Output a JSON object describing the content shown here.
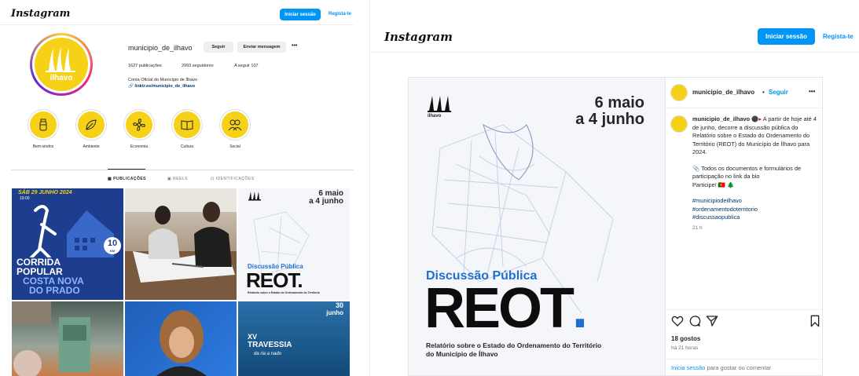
{
  "profile_page": {
    "brand": "Instagram",
    "login_label": "Iniciar sessão",
    "signup_label": "Regista-te",
    "username": "municipio_de_ilhavo",
    "follow_label": "Seguir",
    "message_label": "Enviar mensagem",
    "more_label": "•••",
    "stats": {
      "posts": "1627 publicações",
      "followers": "2993 seguidores",
      "following": "A seguir 107"
    },
    "bio": "Conta Oficial do Município de Ílhavo",
    "link": "linktr.ee/municipio_de_ilhavo",
    "avatar_text": "ílhavo",
    "highlights": [
      {
        "label": "Bem-vindos",
        "icon": "bottle-icon"
      },
      {
        "label": "Ambiente",
        "icon": "leaf-icon"
      },
      {
        "label": "Economia",
        "icon": "fan-icon"
      },
      {
        "label": "Cultura",
        "icon": "book-icon"
      },
      {
        "label": "Social",
        "icon": "people-icon"
      }
    ],
    "tabs": [
      "PUBLICAÇÕES",
      "REELS",
      "IDENTIFICAÇÕES"
    ],
    "tiles": {
      "corrida": {
        "date": "SÁB 29 JUNHO 2024",
        "time": "19:00",
        "distance": "10",
        "unit": "KM",
        "line1": "CORRIDA",
        "line2": "POPULAR",
        "line3": "COSTA NOVA",
        "line4": "DO PRADO"
      },
      "reot_small": {
        "date1": "6 maio",
        "date2": "a 4 junho",
        "subtitle": "Discussão Pública",
        "big": "REOT.",
        "caption": "Relatório sobre o Estado do Ordenamento do Território"
      },
      "travessia": {
        "day": "30",
        "month": "junho",
        "line1": "XV",
        "line2": "TRAVESSIA",
        "line3": "da ria a nado"
      }
    }
  },
  "post_page": {
    "brand": "Instagram",
    "login_label": "Iniciar sessão",
    "signup_label": "Regista-te",
    "image": {
      "logo": "ílhavo",
      "date1": "6 maio",
      "date2": "a 4 junho",
      "subtitle": "Discussão Pública",
      "big_text": "REOT",
      "dot": ".",
      "caption1": "Relatório sobre o Estado do Ordenamento do Território",
      "caption2": "do Município de Ílhavo"
    },
    "header": {
      "username": "municipio_de_ilhavo",
      "separator": "•",
      "follow": "Seguir",
      "more": "•••"
    },
    "caption": {
      "username": "municipio_de_ilhavo",
      "text1": "A partir de hoje até 4 de junho, decorre a discussão pública do Relatório sobre o Estado do Ordenamento do Território (REOT) do Município de Ílhavo para 2024.",
      "text2": "Todos os documentos e formulários de participação no link da bio",
      "text3": "Participe!",
      "hashtags": [
        "#municipiodeilhavo",
        "#ordenamentodoterritorio",
        "#discussaopublica"
      ],
      "time": "21 h"
    },
    "likes": "18 gostos",
    "posted": "há 21 horas",
    "login_prompt_link": "Inicia sessão",
    "login_prompt_rest": " para gostar ou comentar"
  },
  "colors": {
    "accent": "#0095f6",
    "yellow": "#f5d218",
    "navy": "#1d3d8f",
    "reot_blue": "#1f6fd1"
  }
}
